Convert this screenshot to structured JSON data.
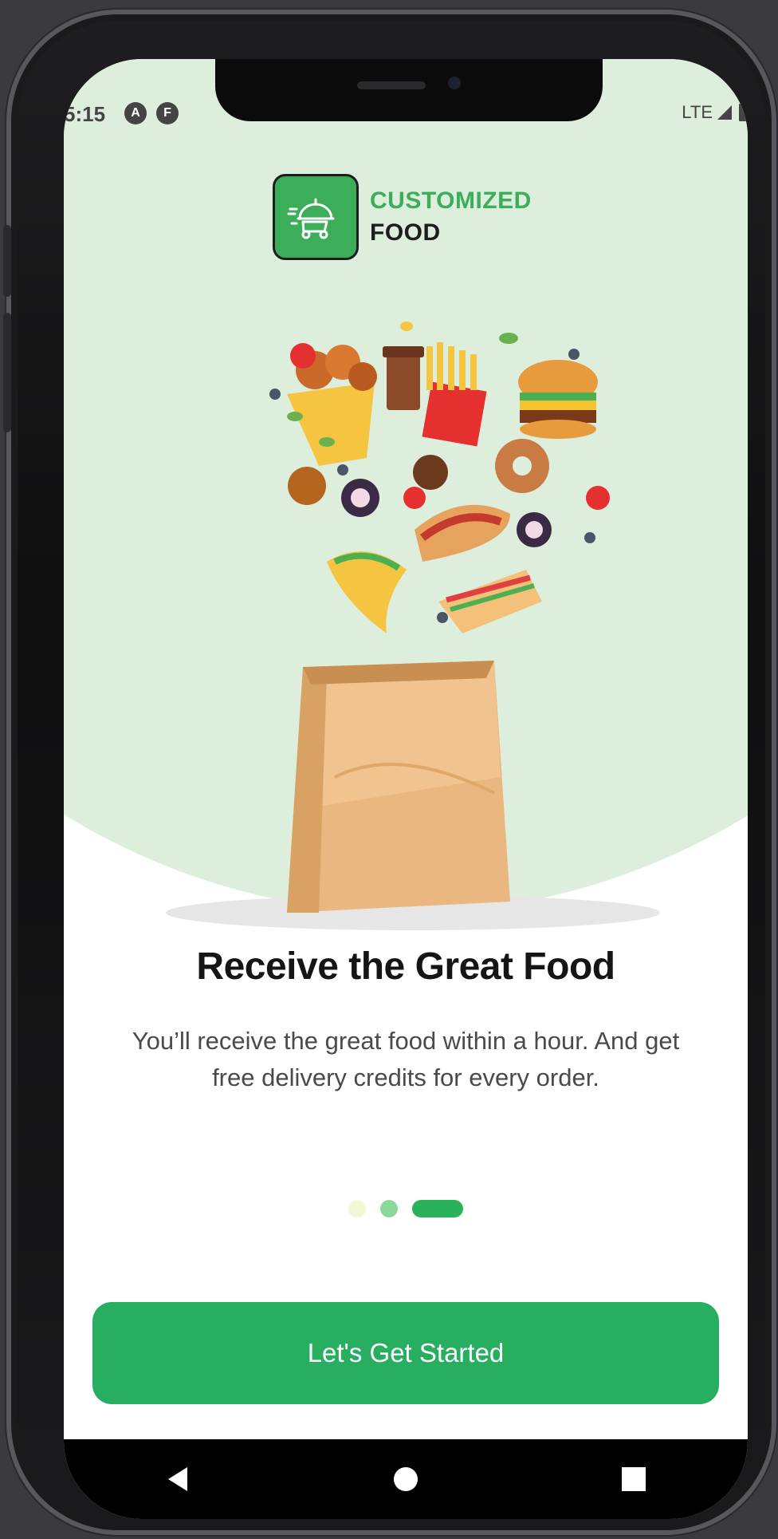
{
  "status_bar": {
    "time": "5:15",
    "left_icons": [
      "A",
      "F"
    ],
    "network": "LTE"
  },
  "logo": {
    "line1": "CUSTOMIZED",
    "line2": "FOOD",
    "icon": "food-delivery-cloche-icon"
  },
  "onboarding": {
    "title": "Receive the Great Food",
    "description": "You’ll receive the great food within a hour. And get free delivery credits for every order.",
    "page_index": 3,
    "page_count": 3
  },
  "cta": {
    "label": "Let's Get Started"
  },
  "nav": {
    "back": "back-icon",
    "home": "home-icon",
    "recents": "recents-icon"
  },
  "colors": {
    "accent": "#27ae60",
    "hero_bg": "#deeedd",
    "title": "#151515",
    "text": "#4a4a4a"
  }
}
